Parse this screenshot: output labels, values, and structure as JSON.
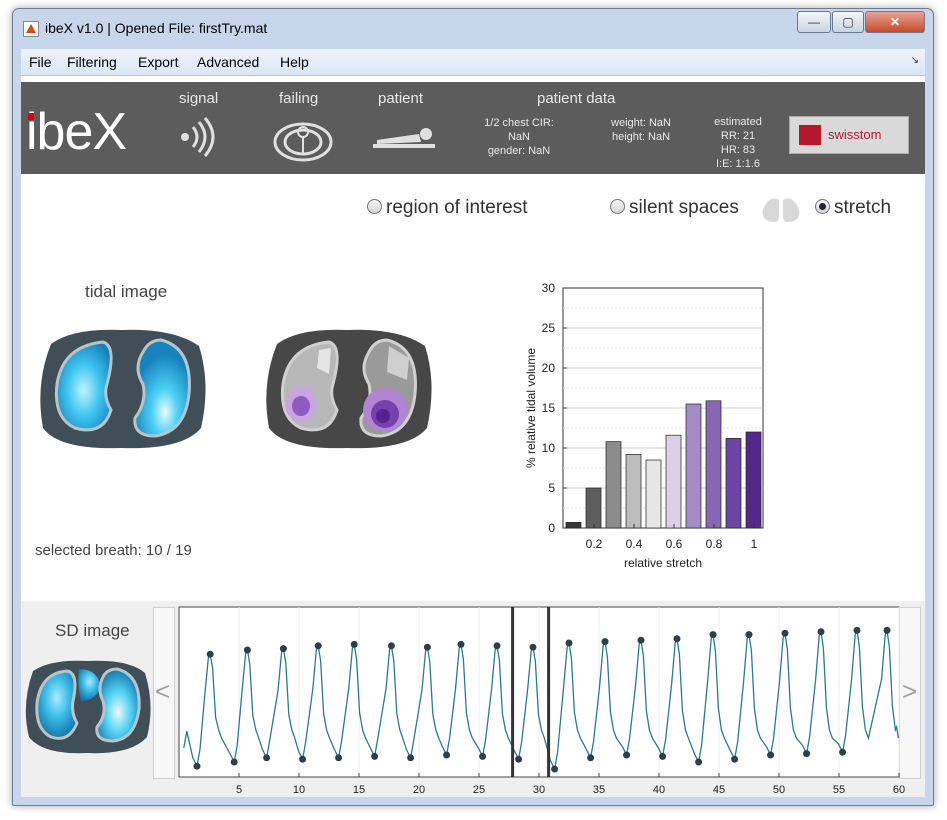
{
  "window": {
    "title": "ibeX v1.0 | Opened File: firstTry.mat",
    "minimize": "—",
    "maximize": "▢",
    "close": "✕"
  },
  "menu": {
    "items": [
      "File",
      "Filtering",
      "Export",
      "Advanced",
      "Help"
    ],
    "corner": "↘"
  },
  "header": {
    "logo": "ibeX",
    "tabs": [
      "signal",
      "failing",
      "patient"
    ],
    "patient_data_title": "patient data",
    "chest_cir_label": "1/2 chest CIR:",
    "chest_cir_value": "NaN",
    "gender": "gender: NaN",
    "weight": "weight: NaN",
    "height": "height: NaN",
    "estimated_label": "estimated",
    "rr": "RR: 21",
    "hr": "HR: 83",
    "ie": "I:E: 1:1.6",
    "brand": "swisstom"
  },
  "mode": {
    "options": [
      "region of interest",
      "silent spaces",
      "stretch"
    ],
    "selected": "stretch"
  },
  "tidal": {
    "title": "tidal image",
    "selected_breath_label": "selected breath:",
    "selected_breath_value": "10 / 19"
  },
  "sd": {
    "title": "SD image",
    "prev": "<",
    "next": ">"
  },
  "chart_data": [
    {
      "type": "bar",
      "xlabel": "relative stretch",
      "ylabel": "% relative tidal volume",
      "ylim": [
        0,
        30
      ],
      "yticks": [
        0,
        5,
        10,
        15,
        20,
        25,
        30
      ],
      "xtick_labels": [
        "0.2",
        "0.4",
        "0.6",
        "0.8",
        "1"
      ],
      "categories": [
        "0.1",
        "0.2",
        "0.3",
        "0.4",
        "0.5",
        "0.6",
        "0.7",
        "0.8",
        "0.9",
        "1.0"
      ],
      "values": [
        0.7,
        5,
        10.8,
        9.2,
        8.5,
        11.6,
        15.5,
        15.9,
        11.2,
        12
      ],
      "colors": [
        "#3a3a3a",
        "#5e5e5e",
        "#8c8c8c",
        "#bdbdbd",
        "#e6e6e6",
        "#dcd0e8",
        "#a58bc6",
        "#8766b3",
        "#6b45a1",
        "#54288b"
      ],
      "grid": true
    },
    {
      "type": "line",
      "xlim": [
        0,
        60
      ],
      "xticks": [
        5,
        10,
        15,
        20,
        25,
        30,
        35,
        40,
        45,
        50,
        55,
        60
      ],
      "selection_markers": [
        27.8,
        30.8
      ],
      "series_color": "#2c7a8e",
      "peak_x": [
        2.6,
        5.7,
        8.7,
        11.6,
        14.6,
        17.7,
        20.7,
        23.5,
        26.5,
        29.5,
        32.5,
        35.5,
        38.5,
        41.5,
        44.5,
        47.5,
        50.5,
        53.5,
        56.5,
        59.0
      ],
      "peak_y": [
        0.82,
        0.85,
        0.86,
        0.88,
        0.89,
        0.88,
        0.87,
        0.89,
        0.88,
        0.87,
        0.9,
        0.91,
        0.92,
        0.93,
        0.96,
        0.96,
        0.97,
        0.98,
        0.99,
        0.99
      ],
      "trough_x": [
        1.5,
        4.6,
        7.3,
        10.3,
        13.3,
        16.3,
        19.3,
        22.3,
        25.3,
        28.3,
        31.3,
        34.3,
        37.3,
        40.3,
        43.3,
        46.3,
        49.3,
        52.3,
        55.3
      ],
      "trough_y": [
        0.02,
        0.05,
        0.08,
        0.07,
        0.08,
        0.09,
        0.08,
        0.1,
        0.09,
        0.07,
        0.0,
        0.08,
        0.1,
        0.09,
        0.05,
        0.07,
        0.1,
        0.11,
        0.12
      ]
    }
  ]
}
